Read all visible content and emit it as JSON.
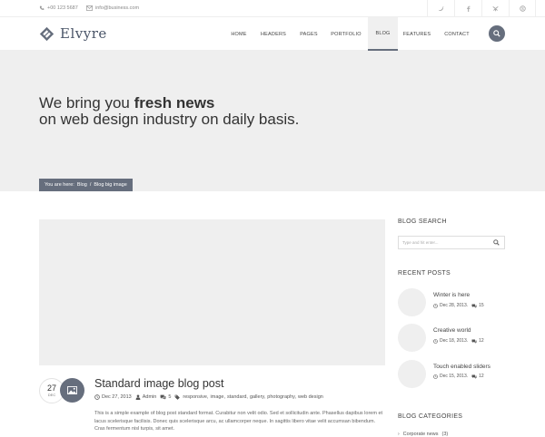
{
  "topbar": {
    "phone": "+00 123 5687",
    "email": "info@business.com",
    "social": [
      "twitter-icon",
      "facebook-icon",
      "vk-icon",
      "skype-icon"
    ]
  },
  "header": {
    "logo_text": "Elvyre",
    "nav": [
      "HOME",
      "HEADERS",
      "PAGES",
      "PORTFOLIO",
      "BLOG",
      "FEATURES",
      "CONTACT"
    ],
    "active_nav": "BLOG"
  },
  "hero": {
    "line1_prefix": "We bring you ",
    "line1_bold": "fresh news",
    "line2": "on web design industry on daily basis."
  },
  "breadcrumb": {
    "prefix": "You are here:",
    "items": [
      "Blog",
      "/",
      "Blog big image"
    ]
  },
  "post": {
    "day": "27",
    "month": "DEC",
    "title": "Standard image blog post",
    "date": "Dec 27, 2013",
    "author": "Admin",
    "comments": "5",
    "tags": [
      "responsive,",
      "image,",
      "standard,",
      "gallery,",
      "photography,",
      "web design"
    ],
    "excerpt": "This is a simple example of blog post standard format. Curabitur non velit odio. Sed et sollicitudin ante. Phasellus dapibus lorem et lacus scelerisque facilisis. Donec quis scelerisque arcu, ac ullamcorper neque. In sagittis libero vitae velit accumsan bibendum. Cras fermentum nisl turpis, sit amet."
  },
  "sidebar": {
    "search_title": "BLOG SEARCH",
    "search_placeholder": "Type and hit enter...",
    "recent_title": "RECENT POSTS",
    "recent": [
      {
        "title": "Winter is here",
        "date": "Dec 28, 2013.",
        "comments": "15"
      },
      {
        "title": "Creative world",
        "date": "Dec 18, 2013.",
        "comments": "12"
      },
      {
        "title": "Touch enabled sliders",
        "date": "Dec 15, 2013.",
        "comments": "12"
      }
    ],
    "categories_title": "BLOG CATEGORIES",
    "categories": [
      {
        "name": "Corporate news",
        "count": "(3)"
      }
    ]
  },
  "colors": {
    "accent": "#666e7d",
    "hero_bg": "#efefef"
  }
}
